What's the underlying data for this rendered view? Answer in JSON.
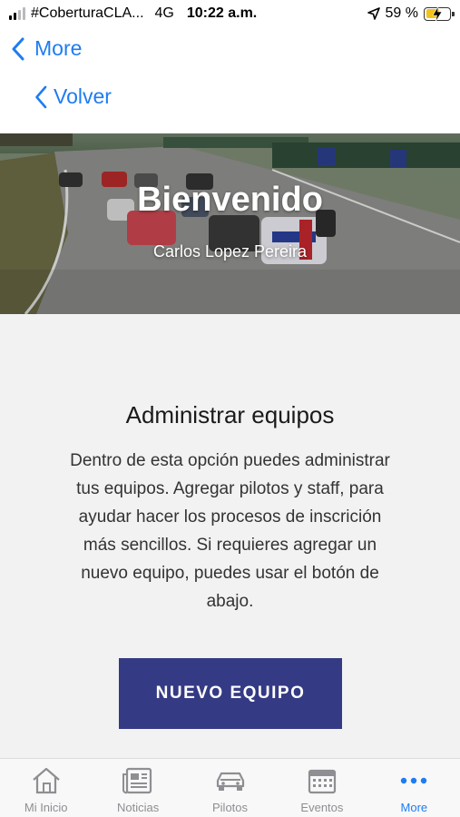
{
  "status_bar": {
    "carrier": "#CoberturaCLA...",
    "network": "4G",
    "time": "10:22 a.m.",
    "battery_percent": "59 %",
    "battery_level": 0.59
  },
  "nav": {
    "back_more_label": "More",
    "back_label": "Volver"
  },
  "hero": {
    "title": "Bienvenido",
    "user_name": "Carlos Lopez Pereira"
  },
  "section": {
    "title": "Administrar equipos",
    "body": "Dentro de esta opción puedes administrar tus equipos. Agregar pilotos y staff, para ayudar hacer los procesos de inscrición más sencillos. Si requieres agregar un nuevo equipo, puedes usar el botón de abajo.",
    "button_label": "NUEVO EQUIPO"
  },
  "colors": {
    "accent": "#1e7cf2",
    "button": "#353a84",
    "inactive": "#8e8e93"
  },
  "tabs": [
    {
      "label": "Mi Inicio",
      "icon": "home-icon",
      "active": false
    },
    {
      "label": "Noticias",
      "icon": "newspaper-icon",
      "active": false
    },
    {
      "label": "Pilotos",
      "icon": "car-icon",
      "active": false
    },
    {
      "label": "Eventos",
      "icon": "calendar-icon",
      "active": false
    },
    {
      "label": "More",
      "icon": "more-dots-icon",
      "active": true
    }
  ]
}
